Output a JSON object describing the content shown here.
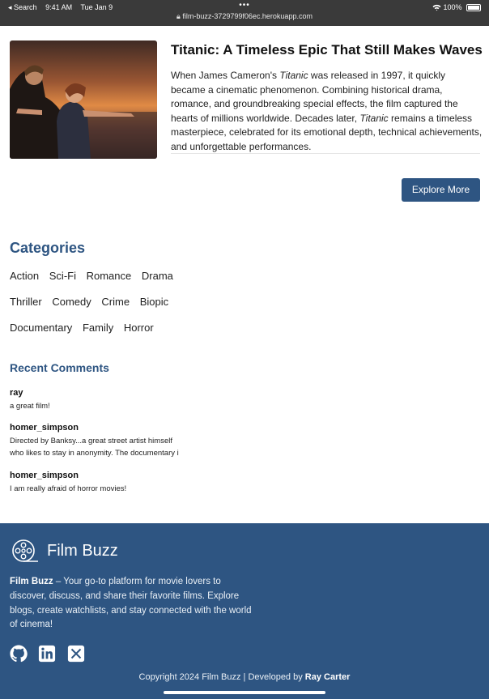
{
  "status_bar": {
    "back_label": "◂ Search",
    "time": "9:41 AM",
    "date": "Tue Jan 9",
    "dots": "•••",
    "url": "film-buzz-3729799f06ec.herokuapp.com",
    "battery": "100%"
  },
  "hero": {
    "image_alt": "Titanic",
    "title": "Titanic: A Timeless Epic That Still Makes Waves",
    "text_1": "When James Cameron's ",
    "text_em_1": "Titanic",
    "text_2": " was released in 1997, it quickly became a cinematic phenomenon. Combining historical drama, romance, and groundbreaking special effects, the film captured the hearts of millions worldwide. Decades later, ",
    "text_em_2": "Titanic",
    "text_3": " remains a timeless masterpiece, celebrated for its emotional depth, technical achievements, and unforgettable performances.",
    "button_label": "Explore More"
  },
  "categories": {
    "title": "Categories",
    "rows": [
      [
        "Action",
        "Sci-Fi",
        "Romance",
        "Drama"
      ],
      [
        "Thriller",
        "Comedy",
        "Crime",
        "Biopic"
      ],
      [
        "Documentary",
        "Family",
        "Horror"
      ]
    ]
  },
  "comments": {
    "title": "Recent Comments",
    "items": [
      {
        "user": "ray",
        "lines": [
          "a great film!"
        ]
      },
      {
        "user": "homer_simpson",
        "lines": [
          "Directed by Banksy...a great street artist himself",
          "who likes to stay in anonymity. The documentary i"
        ]
      },
      {
        "user": "homer_simpson",
        "lines": [
          "I am really afraid of horror movies!"
        ]
      }
    ]
  },
  "footer": {
    "brand": "Film Buzz",
    "desc_bold": "Film Buzz",
    "desc": " – Your go-to platform for movie lovers to discover, discuss, and share their favorite films. Explore blogs, create watchlists, and stay connected with the world of cinema!",
    "socials": [
      "github-icon",
      "linkedin-icon",
      "x-icon"
    ],
    "copyright": "Copyright 2024 Film Buzz | Developed by ",
    "developer": "Ray Carter"
  },
  "colors": {
    "accent": "#2e5582",
    "status_bar": "#3a3a3a"
  }
}
